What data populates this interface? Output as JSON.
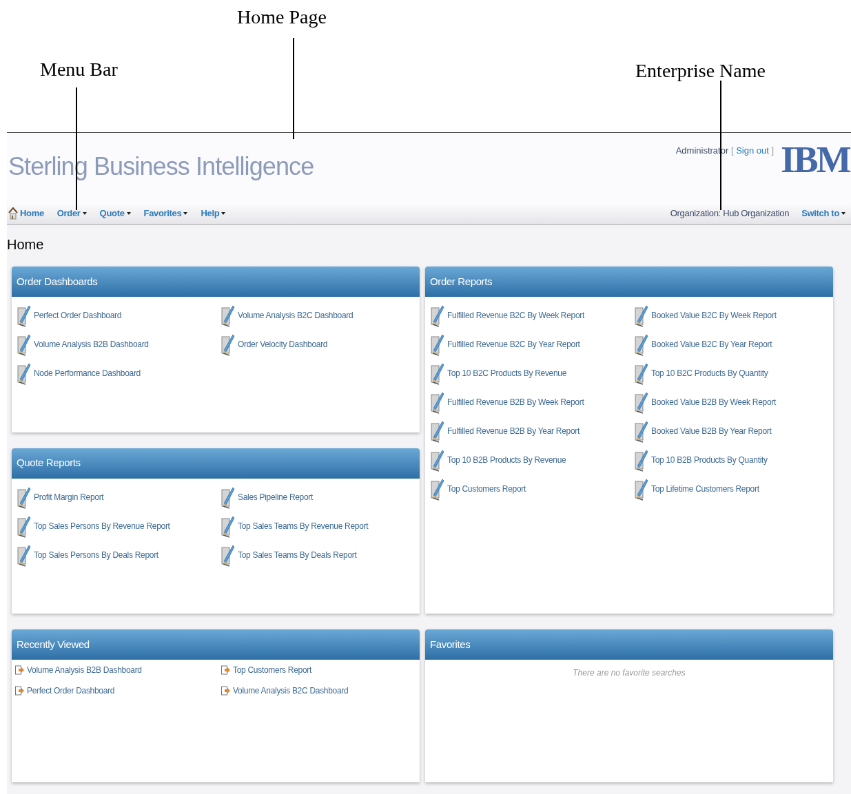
{
  "annotations": [
    {
      "label": "Home Page"
    },
    {
      "label": "Menu Bar"
    },
    {
      "label": "Enterprise Name"
    }
  ],
  "header": {
    "title": "Sterling Business Intelligence",
    "user": "Administrator",
    "bracket_open": "[",
    "sign_out": "Sign out",
    "bracket_close": "]",
    "logo": "IBM",
    "organization": "Organization: Hub Organization",
    "switch_to": "Switch to"
  },
  "menu": [
    {
      "label": "Home",
      "dropdown": false
    },
    {
      "label": "Order",
      "dropdown": true
    },
    {
      "label": "Quote",
      "dropdown": true
    },
    {
      "label": "Favorites",
      "dropdown": true
    },
    {
      "label": "Help",
      "dropdown": true
    }
  ],
  "page_title": "Home",
  "columns": [
    {
      "panels": [
        {
          "title": "Order Dashboards",
          "kind": "reports",
          "items": [
            "Perfect Order Dashboard",
            "Volume Analysis B2C Dashboard",
            "Volume Analysis B2B Dashboard",
            "Order Velocity Dashboard",
            "Node Performance Dashboard"
          ]
        },
        {
          "title": "Quote Reports",
          "kind": "reports",
          "items": [
            "Profit Margin Report",
            "Sales Pipeline Report",
            "Top Sales Persons By Revenue Report",
            "Top Sales Teams By Revenue Report",
            "Top Sales Persons By Deals Report",
            "Top Sales Teams By Deals Report"
          ]
        },
        {
          "title": "Recently Viewed",
          "kind": "recent",
          "items": [
            "Volume Analysis B2B Dashboard",
            "Top Customers Report",
            "Perfect Order Dashboard",
            "Volume Analysis B2C Dashboard"
          ]
        }
      ]
    },
    {
      "panels": [
        {
          "title": "Order Reports",
          "kind": "reports",
          "items": [
            "Fulfilled Revenue B2C By Week Report",
            "Booked Value B2C By Week Report",
            "Fulfilled Revenue B2C By Year Report",
            "Booked Value B2C By Year Report",
            "Top 10 B2C Products By Revenue",
            "Top 10 B2C Products By Quantity",
            "Fulfilled Revenue B2B By Week Report",
            "Booked Value B2B By Week Report",
            "Fulfilled Revenue B2B By Year Report",
            "Booked Value B2B By Year Report",
            "Top 10 B2B Products By Revenue",
            "Top 10 B2B Products By Quantity",
            "Top Customers Report",
            "Top Lifetime Customers Report"
          ]
        },
        {
          "title": "Favorites",
          "kind": "empty",
          "message": "There are no favorite searches"
        }
      ]
    }
  ]
}
